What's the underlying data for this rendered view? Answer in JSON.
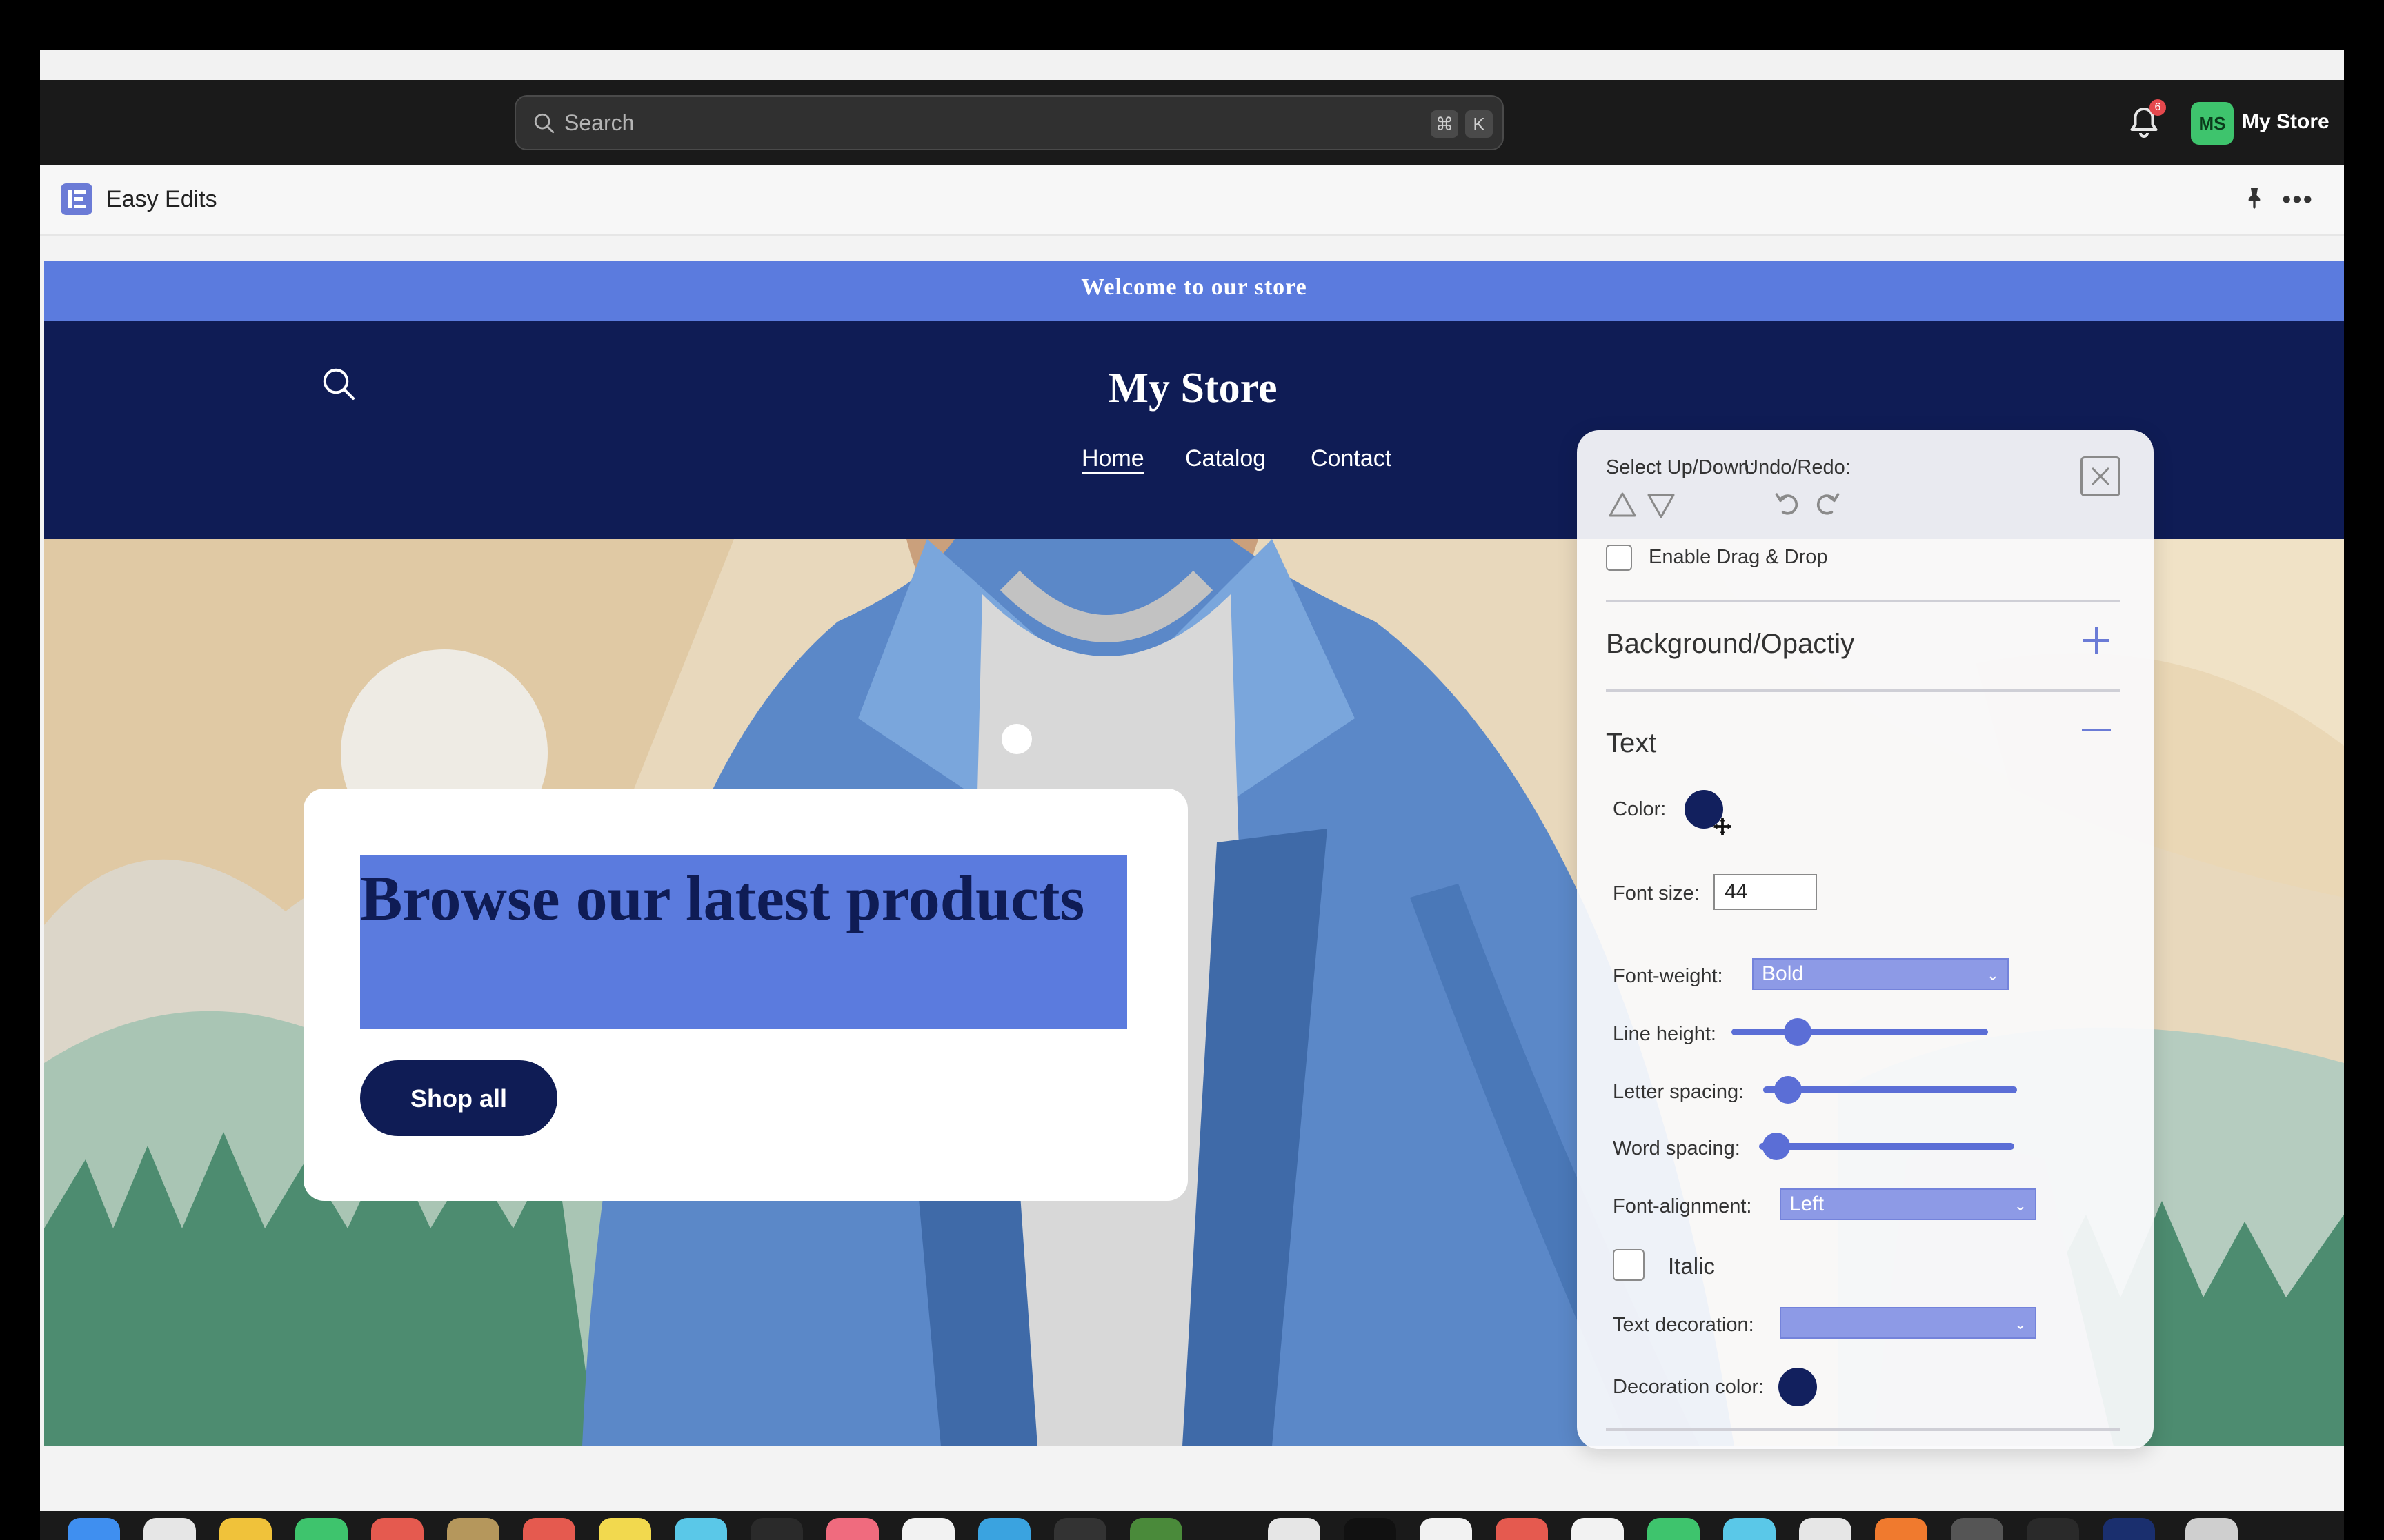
{
  "admin": {
    "search_placeholder": "Search",
    "shortcut_keys": [
      "⌘",
      "K"
    ],
    "notification_count": "6",
    "avatar_initials": "MS",
    "store_name": "My Store"
  },
  "app": {
    "title": "Easy Edits"
  },
  "storefront": {
    "announcement": "Welcome to our store",
    "title": "My Store",
    "nav": [
      "Home",
      "Catalog",
      "Contact"
    ],
    "hero_heading": "Browse our latest products",
    "hero_button": "Shop all"
  },
  "editor": {
    "select_updown_label": "Select Up/Down:",
    "undo_redo_label": "Undo/Redo:",
    "drag_drop_label": "Enable Drag & Drop",
    "drag_drop_enabled": false,
    "background_section": "Background/Opactiy",
    "text_section": "Text",
    "color_label": "Color:",
    "font_size_label": "Font size:",
    "font_size_value": "44",
    "font_weight_label": "Font-weight:",
    "font_weight_value": "Bold",
    "line_height_label": "Line height:",
    "line_height_level": 0.22,
    "letter_spacing_label": "Letter spacing:",
    "letter_spacing_level": 0.06,
    "word_spacing_label": "Word spacing:",
    "word_spacing_level": 0.03,
    "font_alignment_label": "Font-alignment:",
    "font_alignment_value": "Left",
    "italic_label": "Italic",
    "italic_checked": false,
    "text_decoration_label": "Text decoration:",
    "text_decoration_value": "",
    "decoration_color_label": "Decoration color:",
    "text_color": "#12205e",
    "decoration_color": "#12205e"
  },
  "colors": {
    "accent_blue": "#5b7bde",
    "store_navy": "#0f1c55",
    "admin_dark": "#1a1a1a"
  }
}
